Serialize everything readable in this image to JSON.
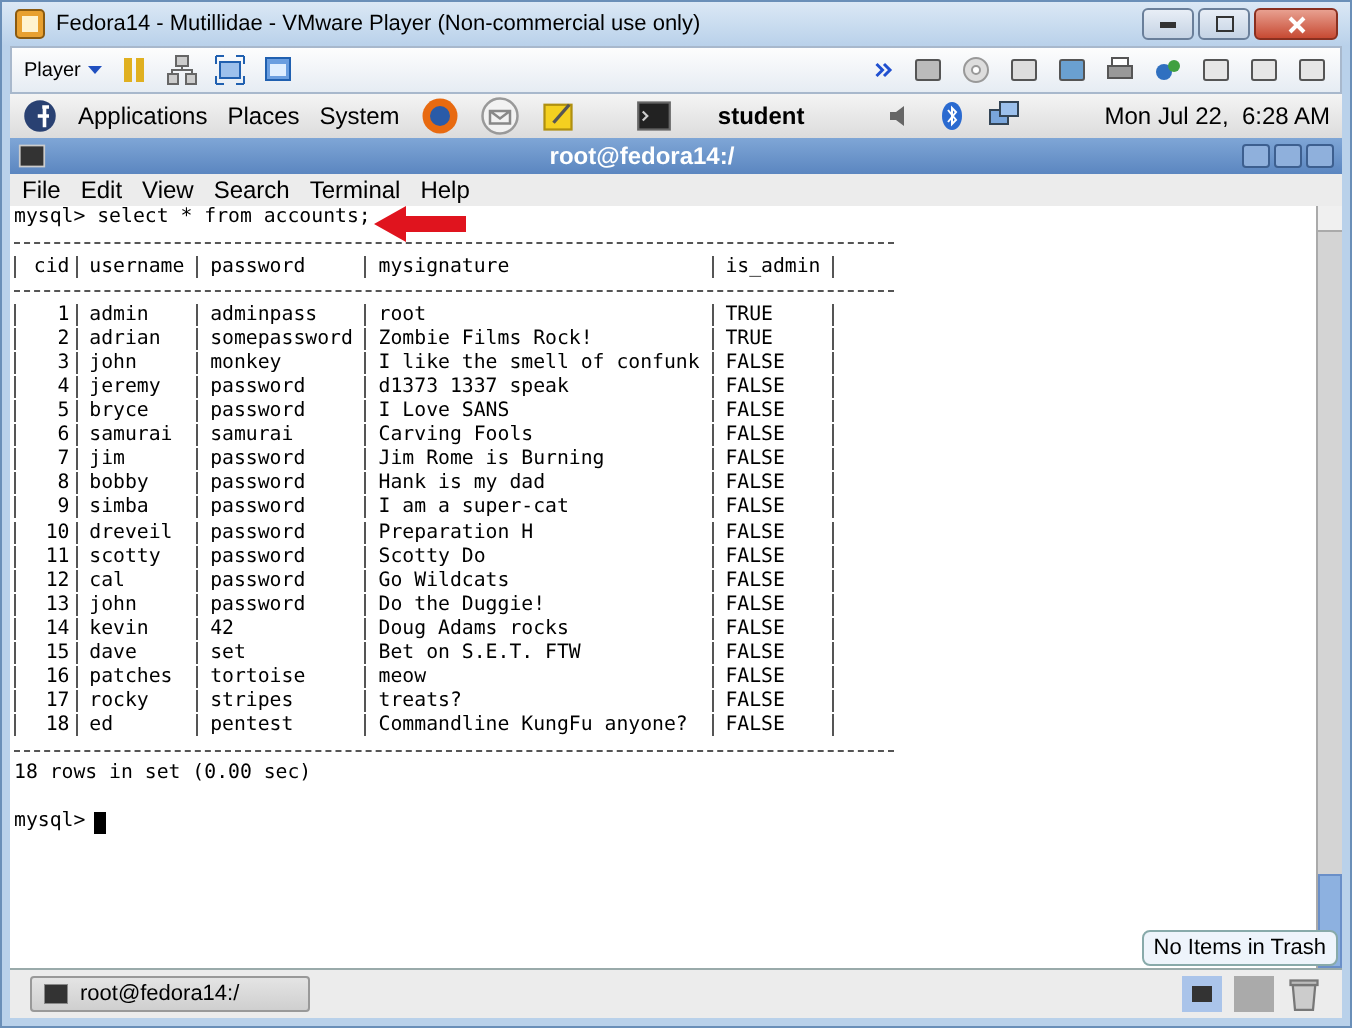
{
  "vm_window": {
    "title": "Fedora14 - Mutillidae - VMware Player (Non-commercial use only)"
  },
  "vm_toolbar": {
    "player_menu": "Player"
  },
  "top_panel": {
    "menus": [
      "Applications",
      "Places",
      "System"
    ],
    "user": "student",
    "clock": "Mon Jul 22,  6:28 AM"
  },
  "terminal": {
    "title": "root@fedora14:/",
    "menu": [
      "File",
      "Edit",
      "View",
      "Search",
      "Terminal",
      "Help"
    ],
    "command_line": "mysql> select * from accounts;",
    "columns": [
      "cid",
      "username",
      "password",
      "mysignature",
      "is_admin"
    ],
    "rows": [
      [
        "1",
        "admin",
        "adminpass",
        "root",
        "TRUE"
      ],
      [
        "2",
        "adrian",
        "somepassword",
        "Zombie Films Rock!",
        "TRUE"
      ],
      [
        "3",
        "john",
        "monkey",
        "I like the smell of confunk",
        "FALSE"
      ],
      [
        "4",
        "jeremy",
        "password",
        "d1373 1337 speak",
        "FALSE"
      ],
      [
        "5",
        "bryce",
        "password",
        "I Love SANS",
        "FALSE"
      ],
      [
        "6",
        "samurai",
        "samurai",
        "Carving Fools",
        "FALSE"
      ],
      [
        "7",
        "jim",
        "password",
        "Jim Rome is Burning",
        "FALSE"
      ],
      [
        "8",
        "bobby",
        "password",
        "Hank is my dad",
        "FALSE"
      ],
      [
        "9",
        "simba",
        "password",
        "I am a super-cat",
        "FALSE"
      ],
      [
        "10",
        "dreveil",
        "password",
        "Preparation H",
        "FALSE"
      ],
      [
        "11",
        "scotty",
        "password",
        "Scotty Do",
        "FALSE"
      ],
      [
        "12",
        "cal",
        "password",
        "Go Wildcats",
        "FALSE"
      ],
      [
        "13",
        "john",
        "password",
        "Do the Duggie!",
        "FALSE"
      ],
      [
        "14",
        "kevin",
        "42",
        "Doug Adams rocks",
        "FALSE"
      ],
      [
        "15",
        "dave",
        "set",
        "Bet on S.E.T. FTW",
        "FALSE"
      ],
      [
        "16",
        "patches",
        "tortoise",
        "meow",
        "FALSE"
      ],
      [
        "17",
        "rocky",
        "stripes",
        "treats?",
        "FALSE"
      ],
      [
        "18",
        "ed",
        "pentest",
        "Commandline KungFu anyone?",
        "FALSE"
      ]
    ],
    "summary": "18 rows in set (0.00 sec)",
    "prompt": "mysql>"
  },
  "bottom_panel": {
    "tasks": [
      {
        "label": "root@fedora14:/"
      }
    ],
    "tooltip": "No Items in Trash"
  }
}
